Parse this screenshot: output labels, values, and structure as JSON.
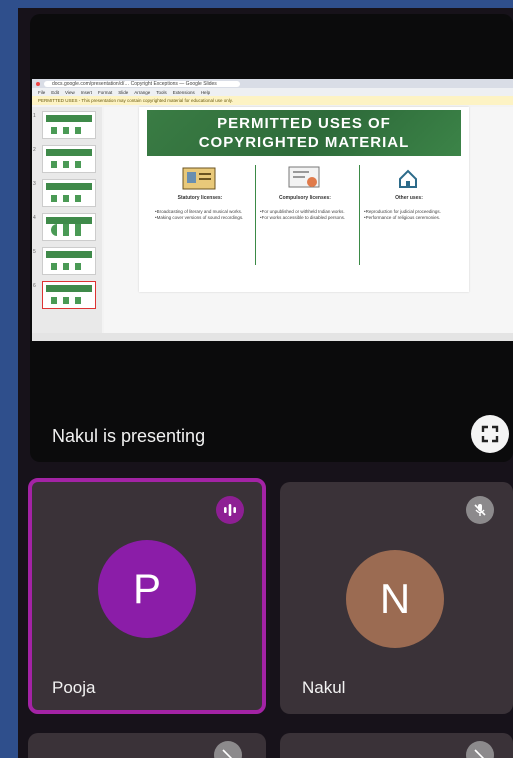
{
  "presentation": {
    "presenting_label": "Nakul is presenting",
    "browser_url": "docs.google.com/presentation/d/… Copyright Exceptions — Google Slides",
    "menu_items": [
      "File",
      "Edit",
      "View",
      "Insert",
      "Format",
      "Slide",
      "Arrange",
      "Tools",
      "Extensions",
      "Help"
    ],
    "warning_text": "PERMITTED USES - This presentation may contain copyrighted material for educational use only.",
    "slide": {
      "title_line1": "PERMITTED USES OF",
      "title_line2": "COPYRIGHTED MATERIAL",
      "columns": [
        {
          "heading": "Statutory licenses:",
          "body": "•Broadcasting of literary and musical works. •Making cover versions of sound recordings."
        },
        {
          "heading": "Compulsory licenses:",
          "body": "•For unpublished or withheld Indian works. •For works accessible to disabled persons."
        },
        {
          "heading": "Other uses:",
          "body": "•Reproduction for judicial proceedings. •Performance of religious ceremonies."
        }
      ]
    },
    "thumbnail_numbers": [
      "1",
      "2",
      "3",
      "4",
      "5",
      "6"
    ],
    "colors": {
      "slide_green": "#3a7c44",
      "active_border": "#a323a5"
    }
  },
  "participants": [
    {
      "name": "Pooja",
      "initial": "P",
      "avatar_color": "#8b1da8",
      "status_icon": "speaking-icon",
      "active": true
    },
    {
      "name": "Nakul",
      "initial": "N",
      "avatar_color": "#9b6b52",
      "status_icon": "mic-off-icon",
      "active": false
    }
  ]
}
